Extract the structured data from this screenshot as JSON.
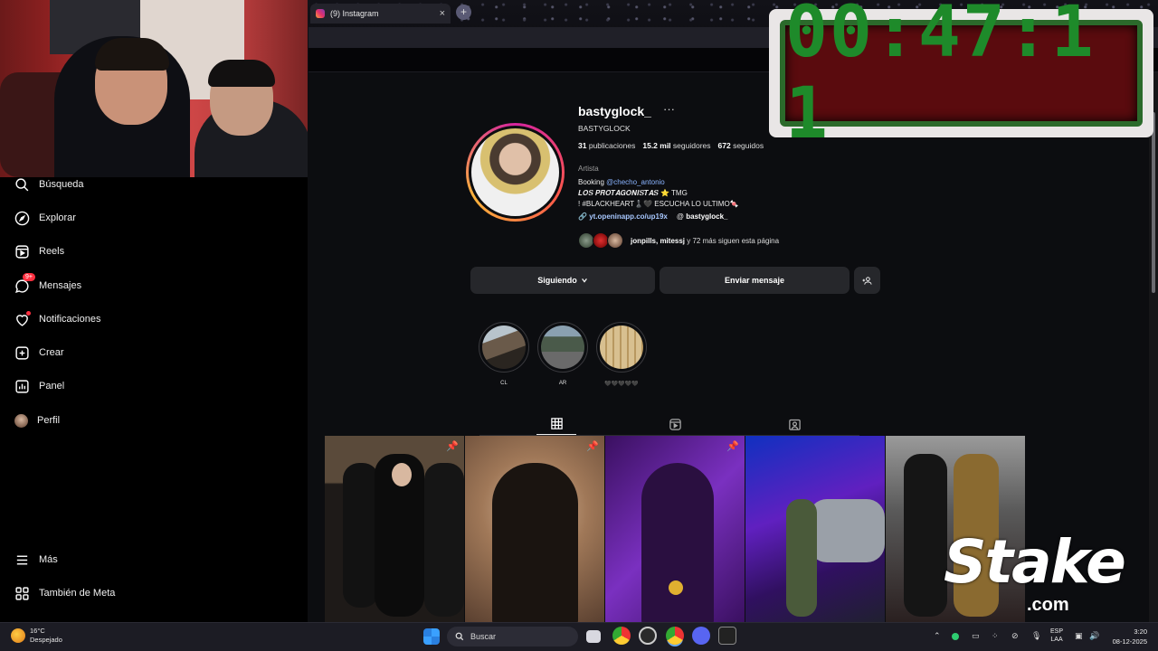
{
  "browser": {
    "tab_title": "(9) Instagram",
    "tab_close": "×",
    "new_tab": "+"
  },
  "timer": {
    "value": "00:47:1 1"
  },
  "sidebar": {
    "items": [
      {
        "label": "Búsqueda",
        "icon": "search-icon"
      },
      {
        "label": "Explorar",
        "icon": "compass-icon"
      },
      {
        "label": "Reels",
        "icon": "reels-icon"
      },
      {
        "label": "Mensajes",
        "icon": "messenger-icon",
        "badge": "9+"
      },
      {
        "label": "Notificaciones",
        "icon": "heart-icon"
      },
      {
        "label": "Crear",
        "icon": "plus-square-icon"
      },
      {
        "label": "Panel",
        "icon": "chart-icon"
      },
      {
        "label": "Perfil",
        "icon": "avatar"
      },
      {
        "label": "Más",
        "icon": "menu-icon"
      },
      {
        "label": "También de Meta",
        "icon": "meta-grid-icon"
      }
    ]
  },
  "profile": {
    "username": "bastyglock_",
    "more": "···",
    "full_name": "BASTYGLOCK",
    "stats": {
      "posts_count": "31",
      "posts_label": "publicaciones",
      "followers_count": "15.2 mil",
      "followers_label": "seguidores",
      "following_count": "672",
      "following_label": "seguidos"
    },
    "category": "Artista",
    "bio_line1_prefix": "Booking ",
    "bio_line1_link": "@checho_antonio",
    "bio_line2": "𝑳𝑶𝑺 𝑷𝑹𝑶𝑻𝑨𝑮𝑶𝑵𝑰𝑺𝑻𝑨𝑺 ⭐ TMG",
    "bio_line3": "! #BLACKHEART♟️🖤 ESCUCHA LO ULTIMO🍬",
    "link_url": "yt.openinapp.co/up19x",
    "threads_handle": "bastyglock_",
    "followed_by_names": "jonpills, mitessj",
    "followed_by_rest": " y 72 más siguen esta página"
  },
  "buttons": {
    "following": "Siguiendo",
    "message": "Enviar mensaje"
  },
  "highlights": [
    {
      "label": "CL"
    },
    {
      "label": "AR"
    },
    {
      "label": "🖤🖤🖤🖤🖤"
    }
  ],
  "posts": [
    {
      "pinned": true,
      "pin": "📌"
    },
    {
      "pinned": true,
      "pin": "📌"
    },
    {
      "pinned": true,
      "pin": "📌"
    },
    {
      "pinned": false
    },
    {
      "pinned": false
    }
  ],
  "overlay_logo": {
    "word": "Stake",
    "domain": ".com"
  },
  "taskbar": {
    "weather_temp": "16°C",
    "weather_desc": "Despejado",
    "search_placeholder": "Buscar",
    "lang_top": "ESP",
    "lang_bottom": "LAA",
    "time": "3:20",
    "date": "08-12-2025"
  },
  "colors": {
    "page_bg": "#0c0d10",
    "sidebar_bg": "#000000",
    "button_bg": "#26272b",
    "link": "#8ab4ff",
    "notification_red": "#ff3040",
    "timer_green": "#1e8a2a",
    "timer_bg": "#5a0b0e"
  }
}
